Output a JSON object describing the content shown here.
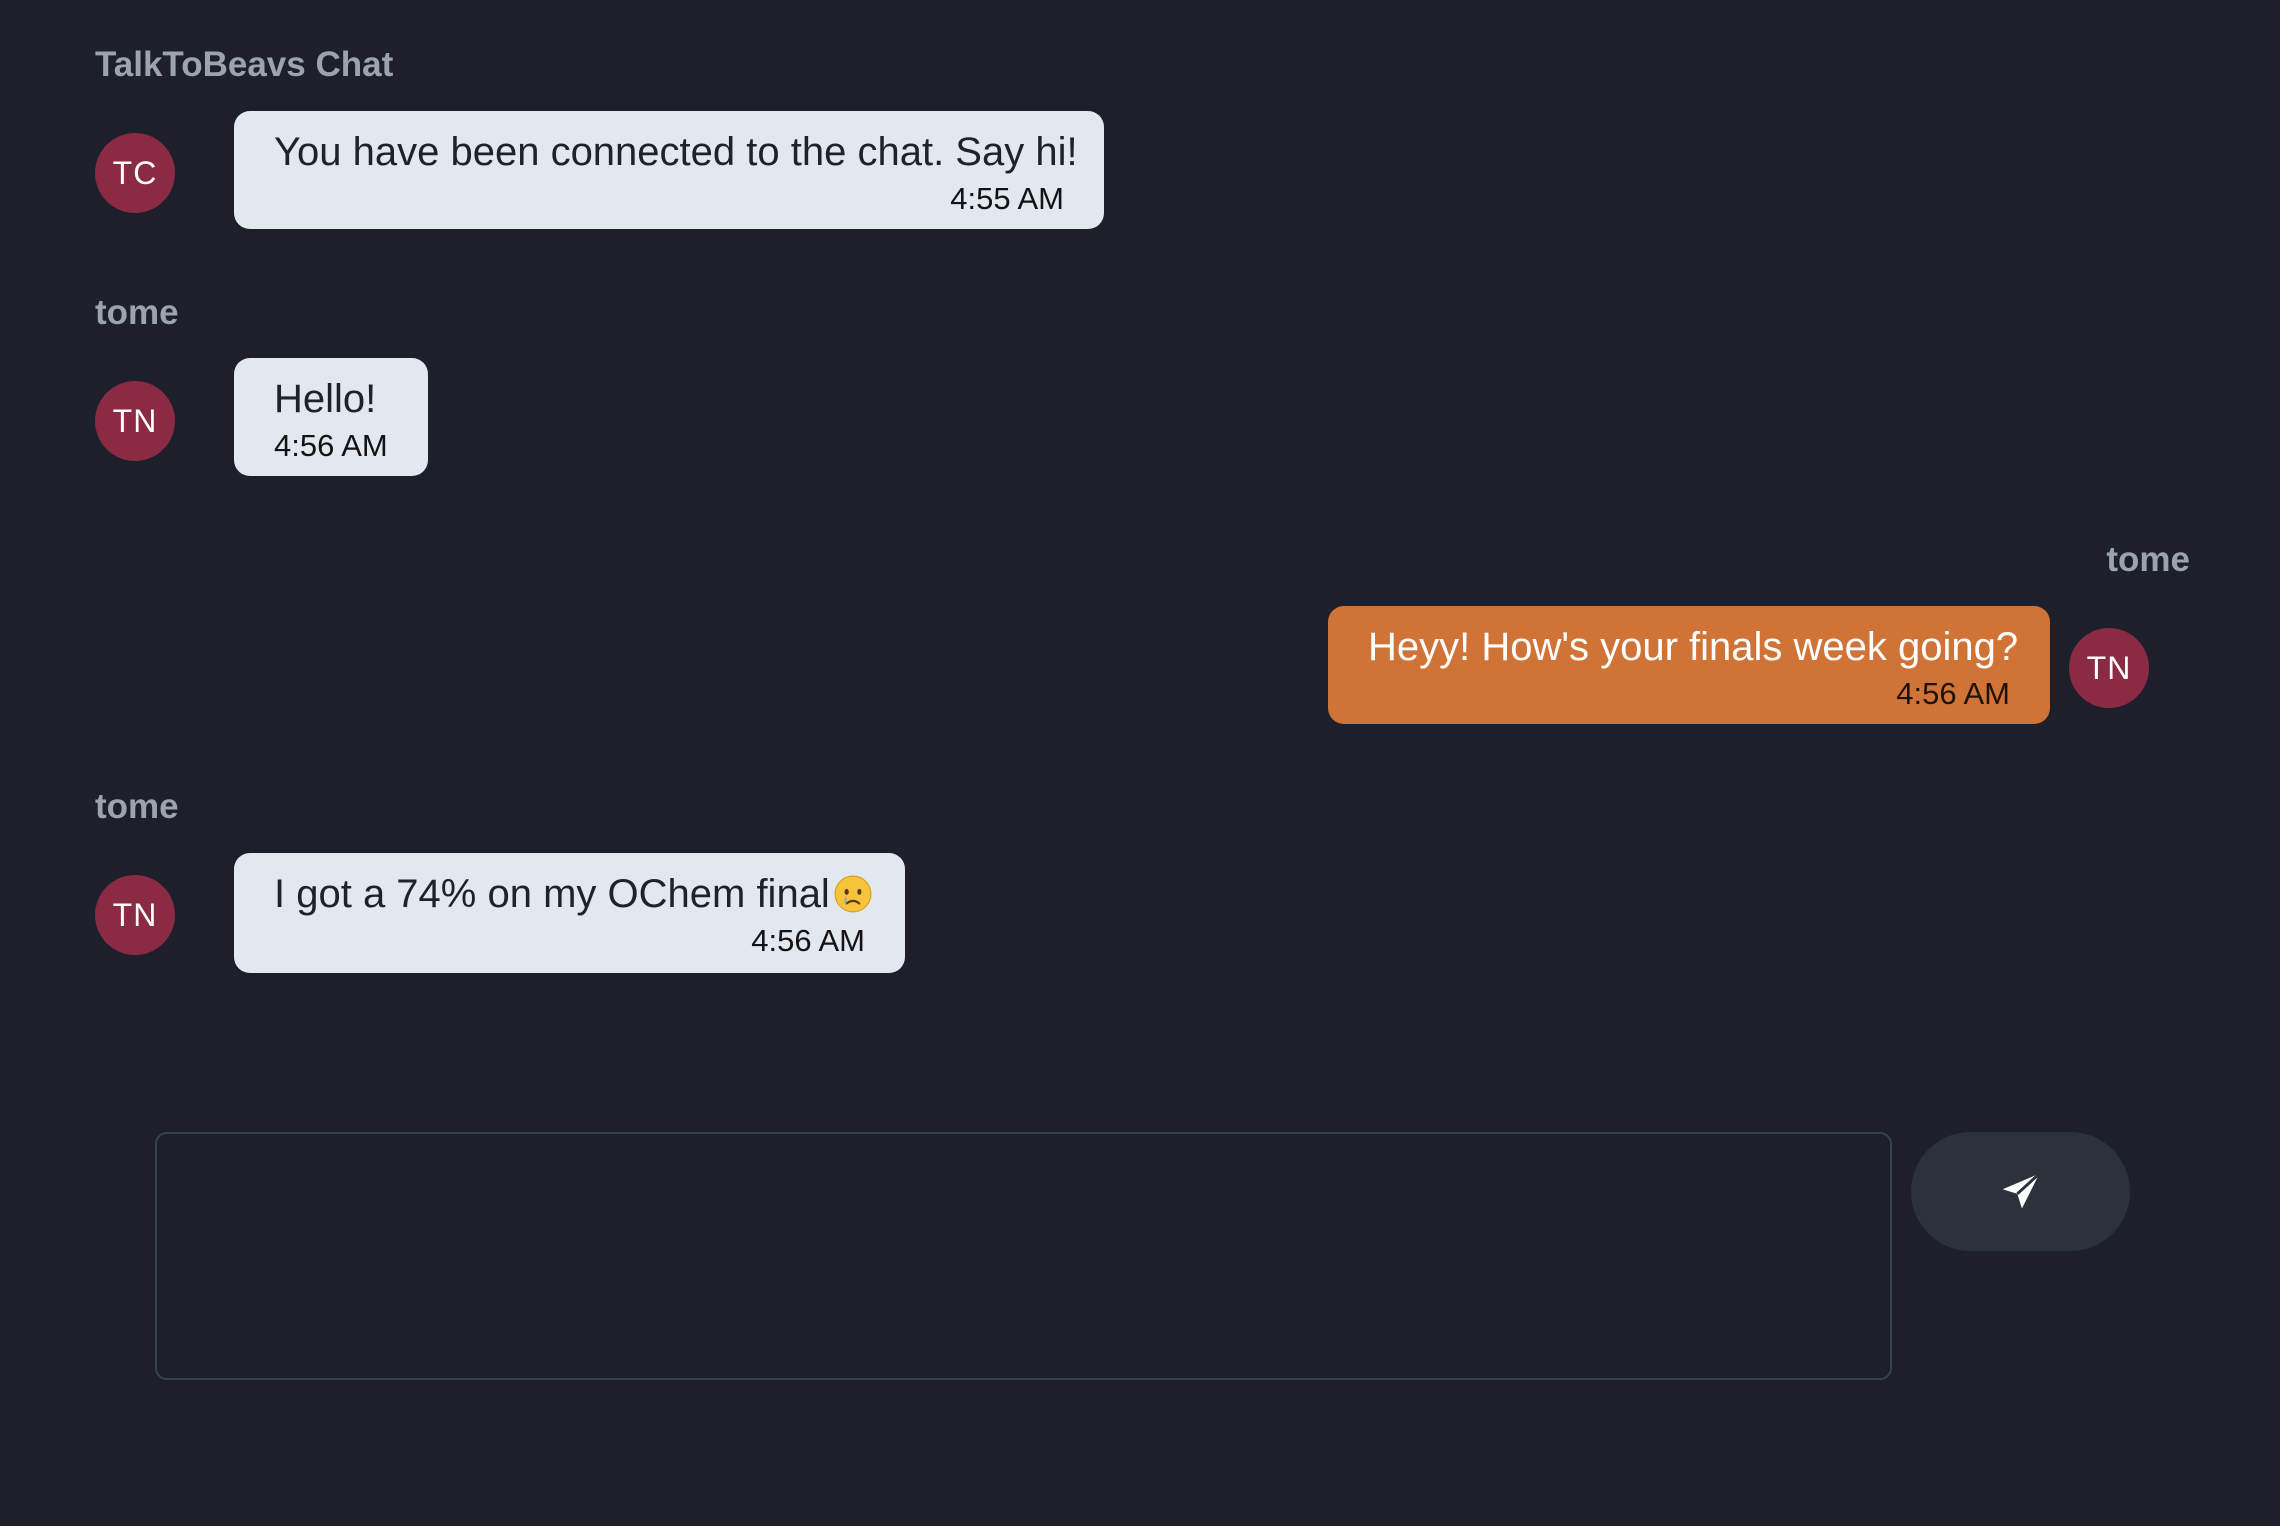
{
  "chat": {
    "title": "TalkToBeavs Chat",
    "messages": [
      {
        "sender": "TalkToBeavs Chat",
        "initials": "TC",
        "text": "You have been connected to the chat. Say hi!",
        "time": "4:55 AM",
        "direction": "received"
      },
      {
        "sender": "tome",
        "initials": "TN",
        "text": "Hello!",
        "time": "4:56 AM",
        "direction": "received"
      },
      {
        "sender": "tome",
        "initials": "TN",
        "text": "Heyy! How's your finals week going?",
        "time": "4:56 AM",
        "direction": "sent"
      },
      {
        "sender": "tome",
        "initials": "TN",
        "text": "I got a 74% on my OChem final",
        "emoji": "crying-face-emoji",
        "time": "4:56 AM",
        "direction": "received"
      }
    ]
  },
  "composer": {
    "value": "",
    "send_icon": "send-icon"
  },
  "colors": {
    "background": "#1d202a",
    "avatar": "#8b2a43",
    "received_bubble": "#e3e7ee",
    "sent_bubble": "#d07337",
    "send_button": "#2d313b",
    "sender_label": "#9ca3af"
  }
}
